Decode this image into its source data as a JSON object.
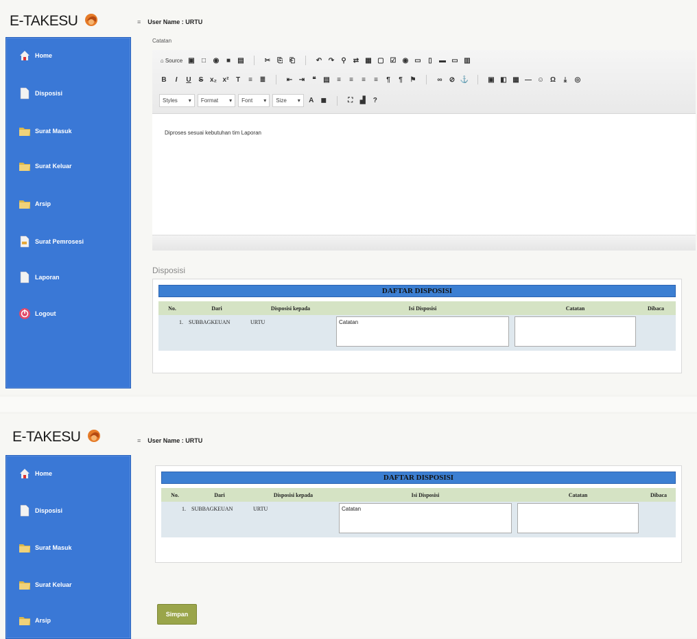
{
  "app": {
    "title": "E-TAKESU"
  },
  "user": {
    "label": "User Name : URTU"
  },
  "sidebar": {
    "items": [
      {
        "label": "Home",
        "icon": "home-icon"
      },
      {
        "label": "Disposisi",
        "icon": "document-icon"
      },
      {
        "label": "Surat Masuk",
        "icon": "folder-icon"
      },
      {
        "label": "Surat Keluar",
        "icon": "folder-icon"
      },
      {
        "label": "Arsip",
        "icon": "folder-icon"
      },
      {
        "label": "Surat Pemrosesi",
        "icon": "document-icon"
      },
      {
        "label": "Laporan",
        "icon": "document-icon"
      },
      {
        "label": "Logout",
        "icon": "logout-icon"
      }
    ]
  },
  "editor": {
    "label": "Catatan",
    "content": "Diproses sesuai kebutuhan tim Laporan",
    "toolbar": {
      "source": "Source",
      "styles": "Styles",
      "format": "Format",
      "font": "Font",
      "size": "Size"
    }
  },
  "disposisi": {
    "section_label": "Disposisi",
    "table_title": "DAFTAR DISPOSISI",
    "columns": [
      "No.",
      "Dari",
      "Disposisi kepada",
      "Isi Disposisi",
      "Catatan",
      "Dibaca"
    ],
    "rows": [
      {
        "no": "1.",
        "dari": "SUBBAGKEUAN",
        "kepada": "URTU",
        "isi": "Catatan",
        "catatan": ""
      }
    ]
  },
  "submit_label": "Simpan",
  "colors": {
    "sidebar": "#3a78d6",
    "table_title": "#3c7fd2",
    "table_header": "#d5e3c4",
    "submit": "#9aa54a"
  }
}
